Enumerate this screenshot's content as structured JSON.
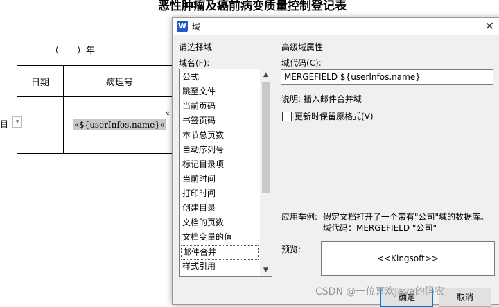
{
  "document": {
    "title": "恶性肿瘤及癌前病变质量控制登记表",
    "year_line": "（　　）年",
    "table_header_date": "日期",
    "table_header_pathology": "病理号",
    "merge_field_display": "«${userInfos.name}»",
    "left_fragment": "目",
    "peek_mark": "«"
  },
  "dialog": {
    "app_icon_letter": "W",
    "title": "域",
    "left_group_label": "请选择域",
    "field_name_label": "域名(F):",
    "field_list": [
      "公式",
      "跳至文件",
      "当前页码",
      "书签页码",
      "本节总页数",
      "自动序列号",
      "标记目录项",
      "当前时间",
      "打印时间",
      "创建目录",
      "文档的页数",
      "文档变量的值",
      "邮件合并",
      "样式引用"
    ],
    "selected_field": "邮件合并",
    "right_group_label": "高级域属性",
    "field_code_label": "域代码(C):",
    "field_code_value": "MERGEFIELD ${userInfos.name}",
    "description": "说明: 插入邮件合并域",
    "preserve_format_label": "更新时保留原格式(V)",
    "preserve_format_checked": false,
    "example_label": "应用举例:",
    "example_line1": "假定文档打开了一个带有\"公司\"域的数据库。",
    "example_line2": "域代码：MERGEFIELD \"公司\"",
    "preview_label": "预览:",
    "preview_value": "<<Kingsoft>>",
    "ok_label": "确定",
    "cancel_label": "取消"
  },
  "watermark": "CSDN @一位喜欢Java的码农"
}
